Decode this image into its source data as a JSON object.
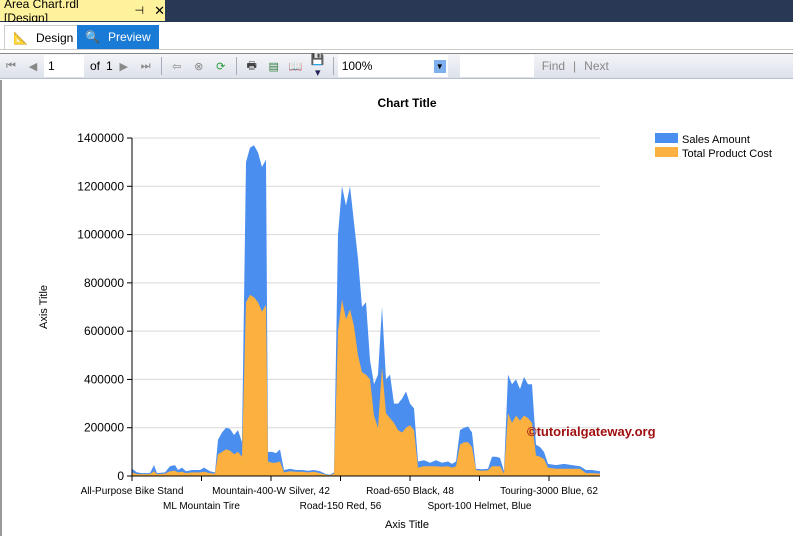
{
  "window": {
    "doc_tab": "Area Chart.rdl [Design]",
    "pin_icon": "⊣",
    "close_icon": "✕"
  },
  "tabs": {
    "design": "Design",
    "preview": "Preview"
  },
  "toolbar": {
    "page": "1",
    "of": "of",
    "total": "1",
    "zoom": "100%",
    "find": "Find",
    "divider": "|",
    "next": "Next"
  },
  "colors": {
    "sales": "#4a8ef0",
    "cost": "#fbb040"
  },
  "watermark": "©tutorialgateway.org",
  "chart_data": {
    "type": "area",
    "title": "Chart Title",
    "xlabel": "Axis Title",
    "ylabel": "Axis Title",
    "ylim": [
      0,
      1400000
    ],
    "yticks": [
      "0",
      "200000",
      "400000",
      "600000",
      "800000",
      "1000000",
      "1200000",
      "1400000"
    ],
    "xlim": [
      0,
      234
    ],
    "xtick_labels": [
      "All-Purpose Bike Stand",
      "ML Mountain Tire",
      "Mountain-400-W Silver, 42",
      "Road-150 Red, 56",
      "Road-650 Black, 48",
      "Sport-100 Helmet, Blue",
      "Touring-3000 Blue, 62"
    ],
    "legend": {
      "position": "top-right",
      "entries": [
        "Sales Amount",
        "Total Product Cost"
      ]
    },
    "x": [
      0,
      2.5,
      5,
      9,
      11,
      12.5,
      16.5,
      19,
      21.5,
      23,
      25,
      27,
      30,
      34,
      36,
      39,
      41.5,
      43,
      45,
      47,
      49,
      51,
      53,
      55,
      57,
      59,
      61,
      63,
      65,
      67,
      68,
      70,
      72,
      74,
      76,
      79,
      82,
      85,
      88,
      91,
      94,
      97,
      99,
      101,
      103,
      105,
      107,
      109,
      111,
      113,
      115,
      117,
      119,
      121,
      123,
      125,
      127,
      129,
      131,
      133,
      135,
      137,
      139,
      141,
      143,
      146,
      149,
      152,
      155,
      158,
      160,
      162,
      164,
      166,
      168,
      170,
      172,
      175,
      178,
      180,
      182,
      184,
      186,
      188,
      190,
      192,
      194,
      196,
      198,
      200,
      202,
      204,
      206,
      208,
      212,
      216,
      220,
      224,
      227,
      230,
      234
    ],
    "series": [
      {
        "name": "Sales Amount",
        "values": [
          30000,
          15000,
          12000,
          12000,
          45000,
          12000,
          15000,
          40000,
          45000,
          25000,
          35000,
          20000,
          25000,
          25000,
          35000,
          20000,
          15000,
          150000,
          180000,
          200000,
          195000,
          170000,
          190000,
          140000,
          1300000,
          1360000,
          1370000,
          1340000,
          1280000,
          1310000,
          100000,
          100000,
          95000,
          110000,
          25000,
          30000,
          25000,
          25000,
          22000,
          25000,
          20000,
          8000,
          5000,
          15000,
          1000000,
          1200000,
          1120000,
          1200000,
          1050000,
          900000,
          700000,
          720000,
          480000,
          380000,
          420000,
          700000,
          400000,
          420000,
          300000,
          300000,
          320000,
          350000,
          300000,
          280000,
          60000,
          65000,
          55000,
          65000,
          55000,
          60000,
          50000,
          60000,
          190000,
          200000,
          205000,
          180000,
          30000,
          28000,
          30000,
          80000,
          80000,
          75000,
          20000,
          420000,
          380000,
          400000,
          360000,
          410000,
          380000,
          380000,
          130000,
          120000,
          100000,
          50000,
          45000,
          50000,
          45000,
          40000,
          25000,
          25000,
          20000
        ]
      },
      {
        "name": "Total Product Cost",
        "values": [
          15000,
          8000,
          8000,
          8000,
          20000,
          8000,
          10000,
          20000,
          22000,
          15000,
          18000,
          12000,
          15000,
          15000,
          18000,
          12000,
          10000,
          90000,
          100000,
          110000,
          105000,
          90000,
          100000,
          80000,
          720000,
          750000,
          740000,
          720000,
          680000,
          710000,
          60000,
          55000,
          55000,
          60000,
          15000,
          20000,
          18000,
          18000,
          15000,
          18000,
          12000,
          5000,
          3000,
          10000,
          600000,
          730000,
          650000,
          690000,
          620000,
          500000,
          430000,
          420000,
          400000,
          250000,
          200000,
          450000,
          260000,
          240000,
          220000,
          190000,
          180000,
          200000,
          210000,
          190000,
          35000,
          40000,
          40000,
          40000,
          38000,
          40000,
          35000,
          40000,
          130000,
          140000,
          140000,
          120000,
          25000,
          22000,
          24000,
          40000,
          40000,
          40000,
          10000,
          260000,
          220000,
          250000,
          230000,
          250000,
          240000,
          220000,
          85000,
          80000,
          70000,
          35000,
          30000,
          30000,
          30000,
          30000,
          12000,
          12000,
          10000
        ]
      }
    ]
  }
}
